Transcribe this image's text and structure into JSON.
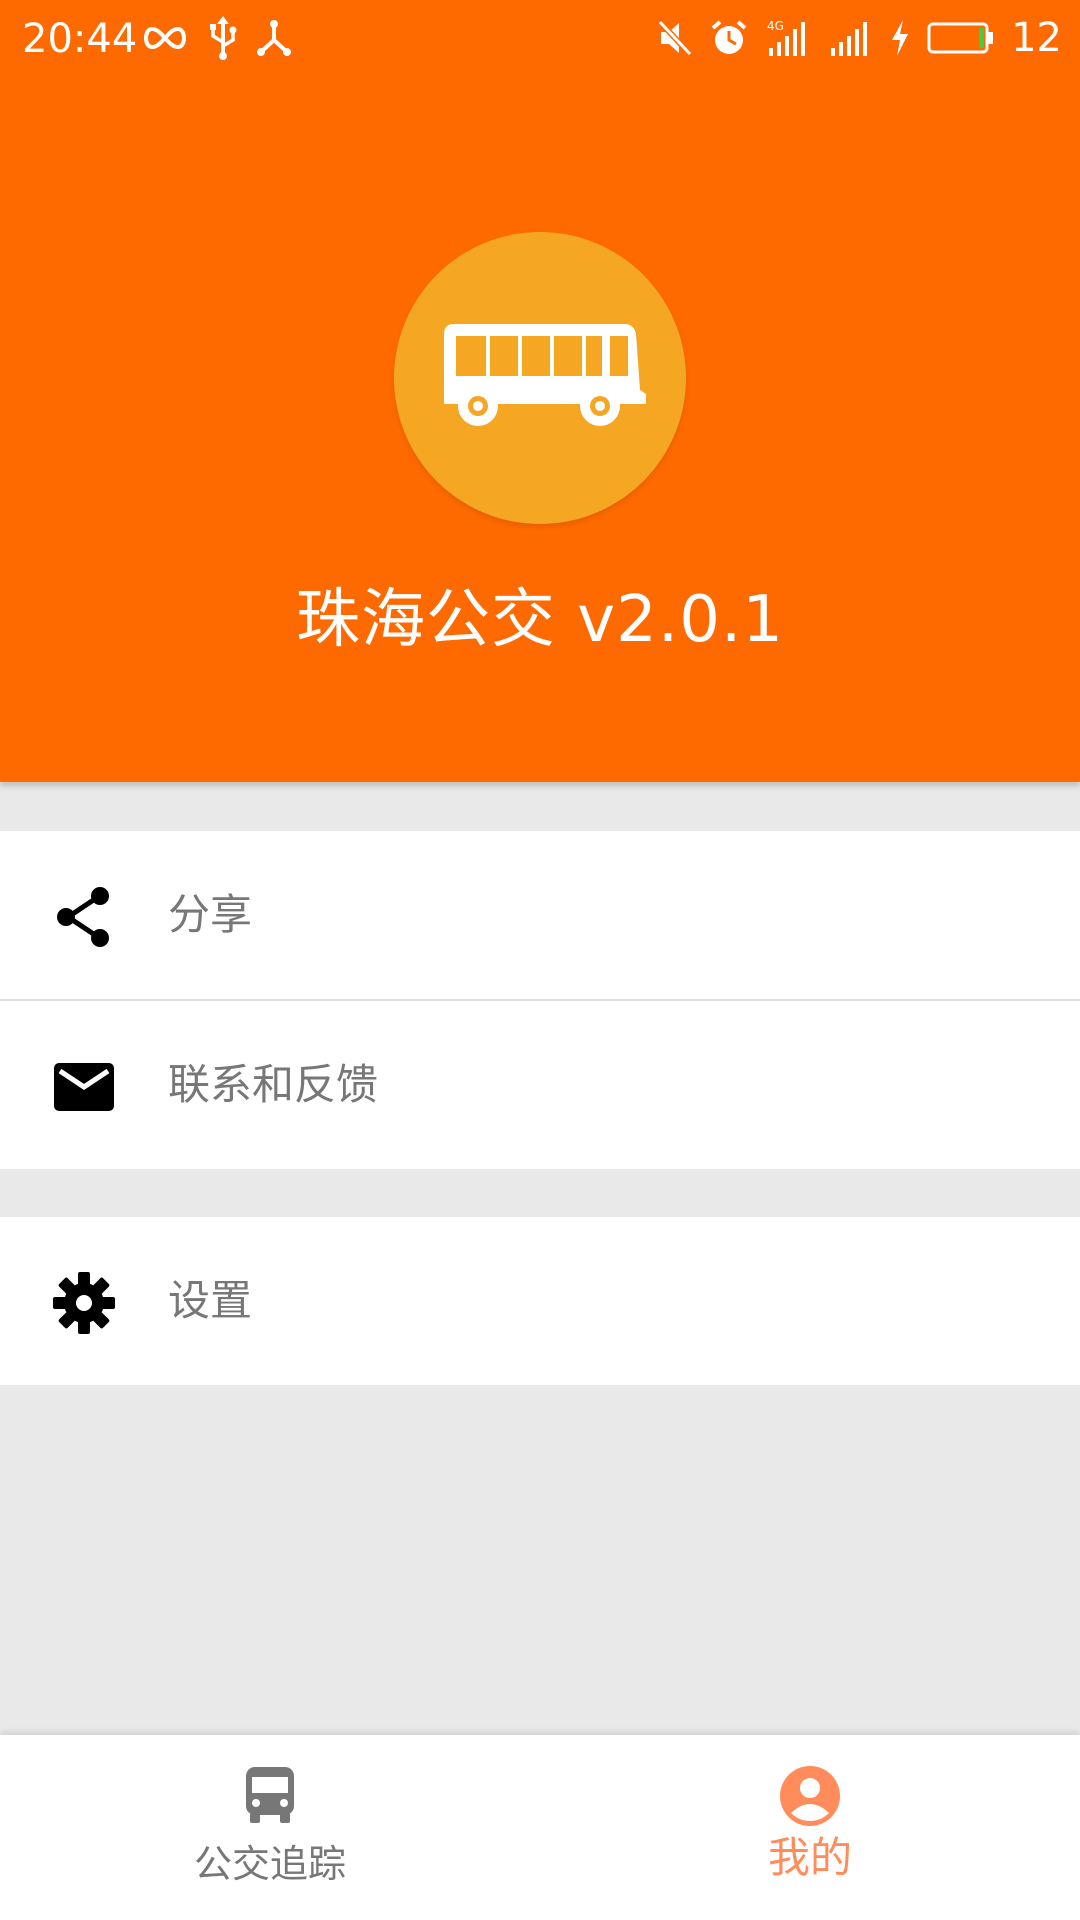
{
  "colors": {
    "header_bg": "#ff6a00",
    "logo_bg": "#f5a623",
    "page_bg": "#e9e9e9",
    "active_tab": "#ff8c5a",
    "inactive_tab": "#777777"
  },
  "status_bar": {
    "time": "20:44",
    "battery": "12",
    "icons_left": [
      "infinity-icon",
      "usb-icon",
      "network-share-icon"
    ],
    "icons_right": [
      "mute-icon",
      "alarm-icon",
      "signal-4g-icon",
      "signal-icon",
      "charging-icon",
      "battery-icon"
    ]
  },
  "header": {
    "logo_icon": "bus-icon",
    "title": "珠海公交 v2.0.1"
  },
  "menu": {
    "share": {
      "label": "分享",
      "icon": "share-icon"
    },
    "feedback": {
      "label": "联系和反馈",
      "icon": "mail-icon"
    },
    "settings": {
      "label": "设置",
      "icon": "gear-icon"
    }
  },
  "bottom_nav": {
    "tabs": [
      {
        "label": "公交追踪",
        "icon": "bus-icon",
        "active": false
      },
      {
        "label": "我的",
        "icon": "account-icon",
        "active": true
      }
    ]
  }
}
